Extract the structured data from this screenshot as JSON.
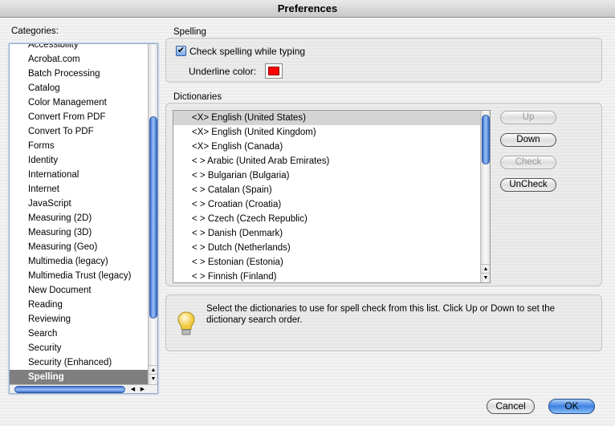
{
  "window": {
    "title": "Preferences"
  },
  "categories": {
    "label": "Categories:",
    "items": [
      "Accessibility",
      "Acrobat.com",
      "Batch Processing",
      "Catalog",
      "Color Management",
      "Convert From PDF",
      "Convert To PDF",
      "Forms",
      "Identity",
      "International",
      "Internet",
      "JavaScript",
      "Measuring (2D)",
      "Measuring (3D)",
      "Measuring (Geo)",
      "Multimedia (legacy)",
      "Multimedia Trust (legacy)",
      "New Document",
      "Reading",
      "Reviewing",
      "Search",
      "Security",
      "Security (Enhanced)",
      "Spelling"
    ],
    "selected": "Spelling"
  },
  "spelling": {
    "label": "Spelling",
    "check_label": "Check spelling while typing",
    "checked": true,
    "underline_label": "Underline color:",
    "underline_color": "#ff0000"
  },
  "dictionaries": {
    "label": "Dictionaries",
    "items": [
      "<X> English (United States)",
      "<X> English (United Kingdom)",
      "<X> English (Canada)",
      "< > Arabic (United Arab Emirates)",
      "< > Bulgarian (Bulgaria)",
      "< > Catalan (Spain)",
      "< > Croatian (Croatia)",
      "< > Czech (Czech Republic)",
      "< > Danish (Denmark)",
      "< > Dutch (Netherlands)",
      "< > Estonian (Estonia)",
      "< > Finnish (Finland)"
    ],
    "buttons": {
      "up": "Up",
      "down": "Down",
      "check": "Check",
      "uncheck": "UnCheck"
    }
  },
  "info": {
    "icon": "lightbulb-icon",
    "text": "Select the dictionaries to use for spell check from this list.  Click Up or Down to set the dictionary search order."
  },
  "footer": {
    "cancel": "Cancel",
    "ok": "OK"
  },
  "colors": {
    "accent": "#3d82e0",
    "selection": "#7f7f7f"
  }
}
